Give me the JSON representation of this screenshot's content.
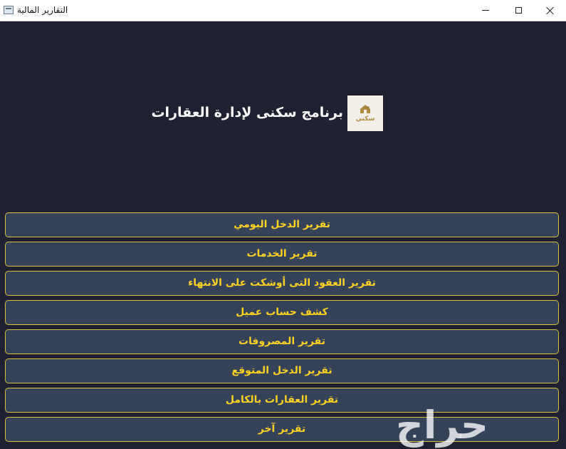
{
  "window": {
    "title": "التقارير المالية"
  },
  "header": {
    "app_title": "برنامج سكنى لإدارة العقارات",
    "logo_text": "سكني"
  },
  "menu": {
    "items": [
      {
        "label": "تقرير الدخل اليومي"
      },
      {
        "label": "تقرير الخدمات"
      },
      {
        "label": "تقرير العقود التى أوشكت على الانتهاء"
      },
      {
        "label": "كشف حساب عميل"
      },
      {
        "label": "تقرير المصروفات"
      },
      {
        "label": "تقرير الدخل المتوقع"
      },
      {
        "label": "تقرير العقارات بالكامل"
      },
      {
        "label": "تقرير آخر"
      }
    ]
  },
  "watermark": {
    "text": "حراج"
  },
  "icons": {
    "app": "window-app-icon",
    "minimize": "minimize-icon",
    "maximize": "maximize-icon",
    "close": "close-icon",
    "logo": "house-logo-icon"
  },
  "colors": {
    "background": "#1f2133",
    "button_fill": "#34435a",
    "button_border": "#d9c23a",
    "button_text": "#ffd21f",
    "title_text": "#ffffff",
    "logo_gold": "#b08a3e"
  }
}
